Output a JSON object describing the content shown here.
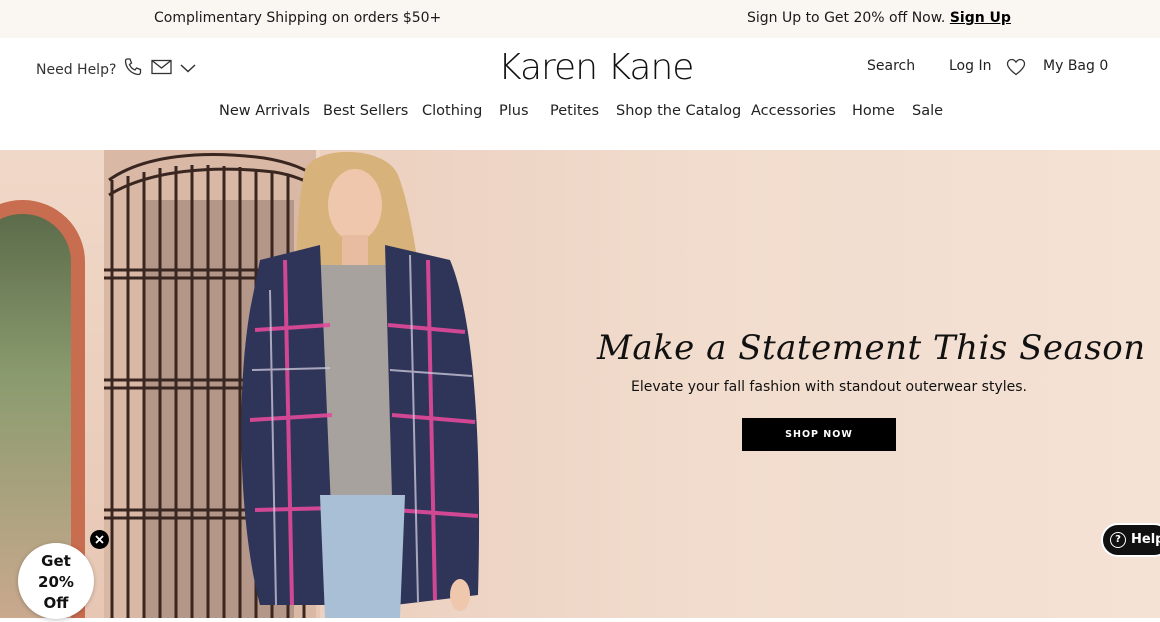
{
  "promo_bar": {
    "shipping_text": "Complimentary Shipping on orders $50+",
    "signup_text": "Sign Up to Get 20% off Now.",
    "signup_link": "Sign Up"
  },
  "header": {
    "need_help": "Need Help?",
    "logo": "Karen Kane",
    "search": "Search",
    "login": "Log In",
    "bag": "My Bag 0"
  },
  "nav": {
    "items": [
      "New Arrivals",
      "Best Sellers",
      "Clothing",
      "Plus",
      "Petites",
      "Shop the Catalog",
      "Accessories",
      "Home",
      "Sale"
    ]
  },
  "hero": {
    "headline": "Make a Statement This Season",
    "subheadline": "Elevate your fall fashion with standout outerwear styles.",
    "cta": "SHOP NOW"
  },
  "widgets": {
    "discount_line1": "Get",
    "discount_line2": "20%",
    "discount_line3": "Off",
    "help": "Help"
  },
  "icons": [
    "phone-icon",
    "mail-icon",
    "chevron-down-icon",
    "heart-icon",
    "close-icon",
    "question-icon"
  ]
}
